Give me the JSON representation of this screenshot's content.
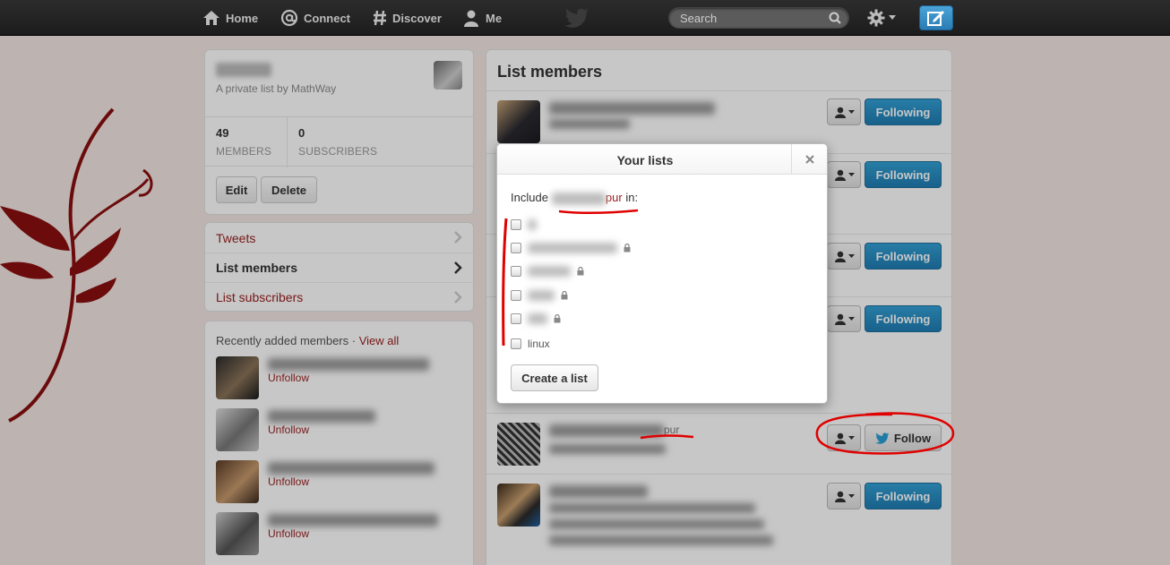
{
  "topbar": {
    "home": "Home",
    "connect": "Connect",
    "discover": "Discover",
    "me": "Me",
    "search_placeholder": "Search"
  },
  "list_info": {
    "subtitle": "A private list by MathWay",
    "members_count": "49",
    "members_label": "MEMBERS",
    "subscribers_count": "0",
    "subscribers_label": "SUBSCRIBERS",
    "edit_label": "Edit",
    "delete_label": "Delete"
  },
  "list_nav": {
    "tweets": "Tweets",
    "members": "List members",
    "subscribers": "List subscribers"
  },
  "recent": {
    "title": "Recently added members",
    "separator": "·",
    "view_all": "View all",
    "unfollow": "Unfollow"
  },
  "members": {
    "title": "List members",
    "following_label": "Following",
    "follow_label": "Follow",
    "pur_fragment": "pur"
  },
  "dialog": {
    "title": "Your lists",
    "include_prefix": "Include",
    "include_suffix": "pur",
    "include_end": "in:",
    "visible_list_name": "linux",
    "create_label": "Create a list"
  },
  "colors": {
    "accent_red": "#9a2020",
    "following_blue": "#1f7db3",
    "annotation_red": "#e00000"
  }
}
